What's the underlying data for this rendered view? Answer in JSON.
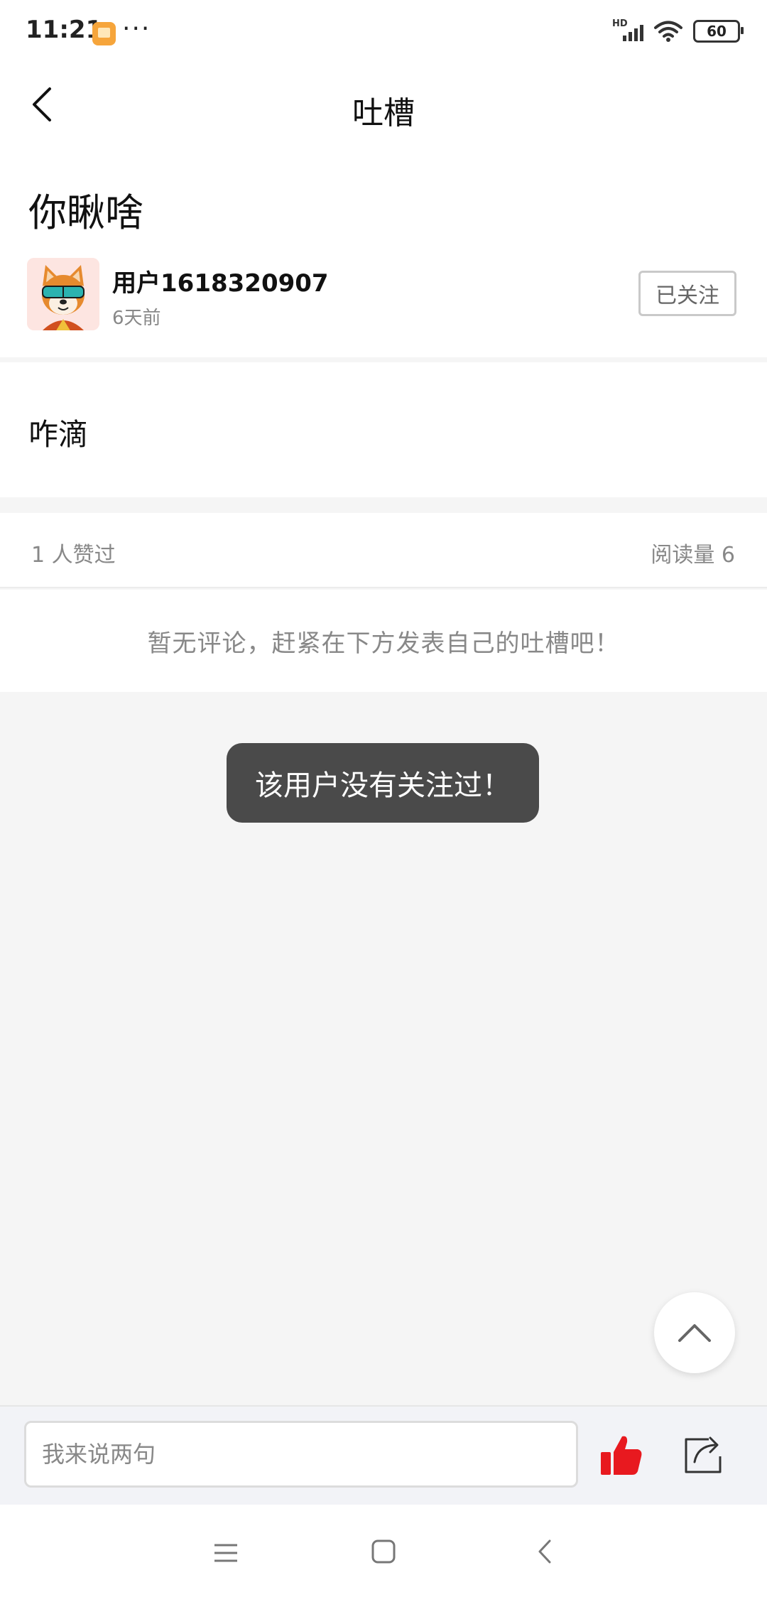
{
  "status_bar": {
    "time": "11:21",
    "dots": "···",
    "network": "HD",
    "battery": "60",
    "app_icon": "orange-app-icon",
    "icons": [
      "signal-icon",
      "wifi-icon",
      "battery-icon"
    ]
  },
  "header": {
    "title": "吐槽",
    "back_icon": "chevron-left-icon"
  },
  "post": {
    "title": "你瞅啥",
    "author": "用户1618320907",
    "time": "6天前",
    "follow_label": "已关注",
    "avatar_icon": "shiba-dog-avatar",
    "content": "咋滴"
  },
  "stats": {
    "likes": "1 人赞过",
    "reads": "阅读量 6"
  },
  "comments": {
    "empty_text": "暂无评论，赶紧在下方发表自己的吐槽吧！"
  },
  "toast": {
    "text": "该用户没有关注过！"
  },
  "bottom_bar": {
    "input_placeholder": "我来说两句",
    "like_icon": "thumbs-up-icon",
    "share_icon": "share-icon"
  },
  "nav_bar": {
    "icons": [
      "menu-icon",
      "home-icon",
      "back-icon"
    ]
  },
  "colors": {
    "accent_red": "#e8191f",
    "toast_bg": "#4a4a4a",
    "page_bg": "#f5f5f5"
  }
}
